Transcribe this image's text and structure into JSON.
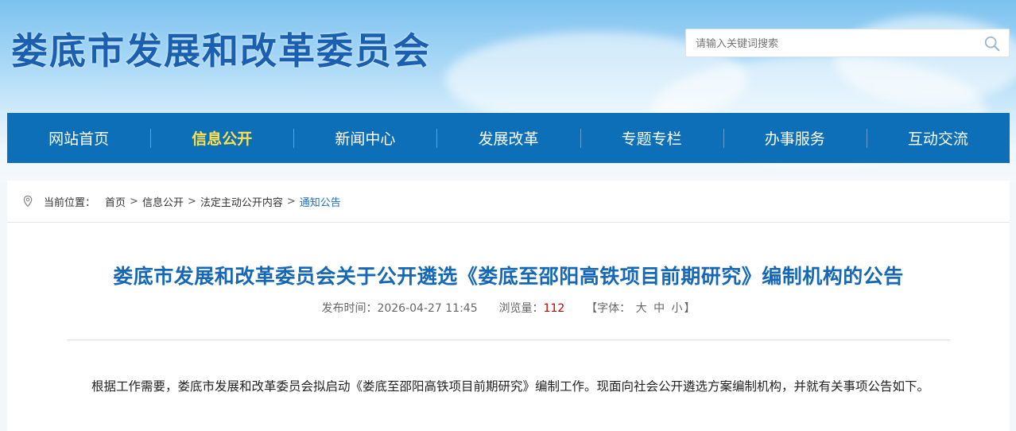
{
  "header": {
    "site_title": "娄底市发展和改革委员会",
    "search_placeholder": "请输入关键词搜索"
  },
  "nav": {
    "items": [
      {
        "label": "网站首页"
      },
      {
        "label": "信息公开"
      },
      {
        "label": "新闻中心"
      },
      {
        "label": "发展改革"
      },
      {
        "label": "专题专栏"
      },
      {
        "label": "办事服务"
      },
      {
        "label": "互动交流"
      }
    ],
    "active_index": 1
  },
  "breadcrumb": {
    "label": "当前位置：",
    "items": [
      "首页",
      "信息公开",
      "法定主动公开内容",
      "通知公告"
    ],
    "separator": ">"
  },
  "article": {
    "title": "娄底市发展和改革委员会关于公开遴选《娄底至邵阳高铁项目前期研究》编制机构的公告",
    "publish_label": "发布时间：",
    "publish_time": "2026-04-27 11:45",
    "views_label": "浏览量：",
    "views_count": "112",
    "font_open": "【字体：",
    "font_large": "大",
    "font_medium": "中",
    "font_small": "小",
    "font_close": "】",
    "paragraph": "根据工作需要，娄底市发展和改革委员会拟启动《娄底至邵阳高铁项目前期研究》编制工作。现面向社会公开遴选方案编制机构，并就有关事项公告如下。"
  },
  "colors": {
    "nav_bg": "#0d6fb8",
    "nav_active": "#ffe14a",
    "title_blue": "#1668b6",
    "views_red": "#c00000",
    "crumb_current": "#1a6fc0"
  },
  "icons": [
    "search-icon",
    "location-pin-icon"
  ]
}
